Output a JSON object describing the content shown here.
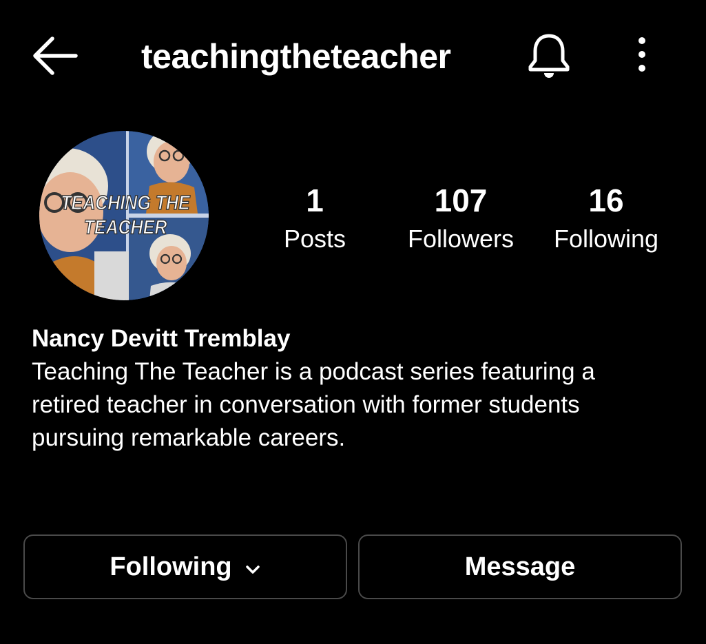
{
  "header": {
    "username": "teachingtheteacher",
    "back_icon": "arrow-left-icon",
    "bell_icon": "bell-icon",
    "more_icon": "more-vertical-icon"
  },
  "avatar": {
    "overlay_line1": "TEACHING THE",
    "overlay_line2": "TEACHER"
  },
  "stats": [
    {
      "value": "1",
      "label": "Posts"
    },
    {
      "value": "107",
      "label": "Followers"
    },
    {
      "value": "16",
      "label": "Following"
    }
  ],
  "profile": {
    "name": "Nancy Devitt Tremblay",
    "bio": "Teaching The Teacher is a podcast series featuring a\nretired teacher in conversation with former students\npursuing remarkable careers."
  },
  "actions": {
    "following_label": "Following",
    "message_label": "Message",
    "chevron_icon": "chevron-down-icon"
  },
  "colors": {
    "background": "#000000",
    "text": "#ffffff",
    "button_border": "#4a4a4a"
  }
}
